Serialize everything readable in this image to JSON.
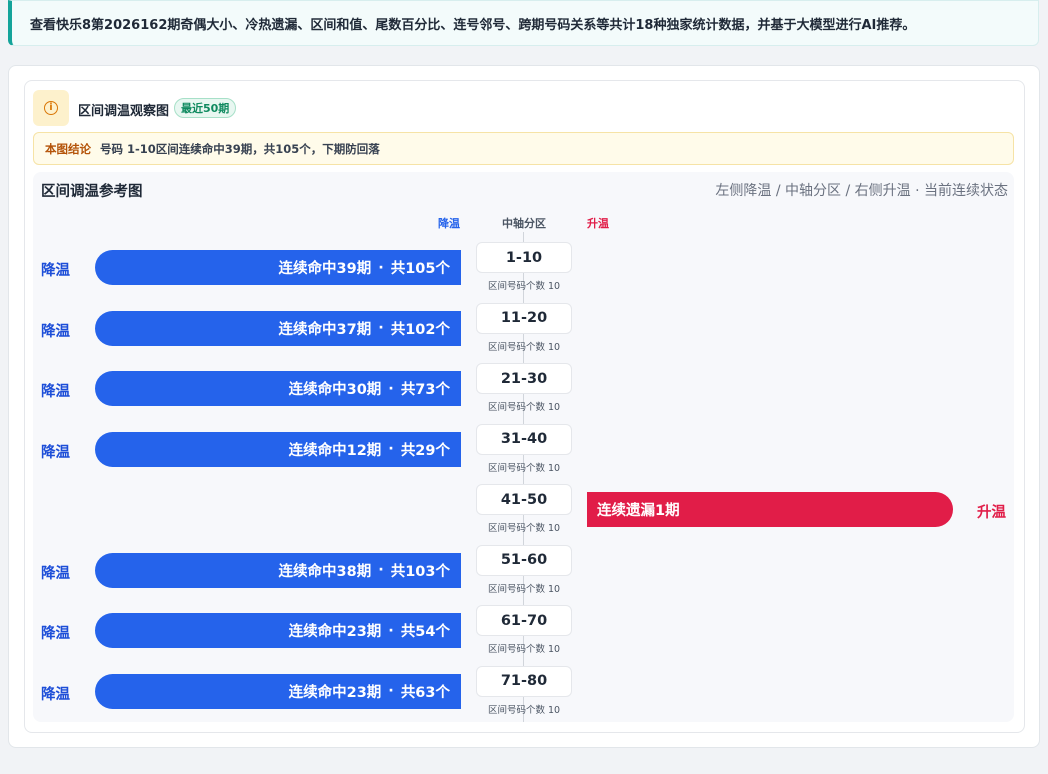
{
  "notice": "查看快乐8第2026162期奇偶大小、冷热遗漏、区间和值、尾数百分比、连号邻号、跨期号码关系等共计18种独家统计数据，并基于大模型进行AI推荐。",
  "card": {
    "icon": "info-icon",
    "title": "区间调温观察图",
    "badge": "最近50期"
  },
  "conclusion": {
    "label": "本图结论",
    "text": "号码 1-10区间连续命中39期，共105个，下期防回落"
  },
  "chart": {
    "title": "区间调温参考图",
    "subtitle": "左侧降温 / 中轴分区 / 右侧升温 · 当前连续状态",
    "header_cool": "降温",
    "header_axis": "中轴分区",
    "header_warm": "升温",
    "colors": {
      "cool": "#2563eb",
      "warm": "#e11d48"
    }
  },
  "chart_data": {
    "type": "bar",
    "categories": [
      "1-10",
      "11-20",
      "21-30",
      "31-40",
      "41-50",
      "51-60",
      "61-70",
      "71-80"
    ],
    "rows": [
      {
        "zone": "1-10",
        "count_label": "区间号码个数 10",
        "direction": "cool",
        "dir_label": "降温",
        "bar_text": "连续命中39期",
        "total_text": "共105个",
        "streak": 39,
        "total": 105
      },
      {
        "zone": "11-20",
        "count_label": "区间号码个数 10",
        "direction": "cool",
        "dir_label": "降温",
        "bar_text": "连续命中37期",
        "total_text": "共102个",
        "streak": 37,
        "total": 102
      },
      {
        "zone": "21-30",
        "count_label": "区间号码个数 10",
        "direction": "cool",
        "dir_label": "降温",
        "bar_text": "连续命中30期",
        "total_text": "共73个",
        "streak": 30,
        "total": 73
      },
      {
        "zone": "31-40",
        "count_label": "区间号码个数 10",
        "direction": "cool",
        "dir_label": "降温",
        "bar_text": "连续命中12期",
        "total_text": "共29个",
        "streak": 12,
        "total": 29
      },
      {
        "zone": "41-50",
        "count_label": "区间号码个数 10",
        "direction": "warm",
        "dir_label": "升温",
        "bar_text": "连续遗漏1期",
        "total_text": "",
        "streak": 1,
        "total": null
      },
      {
        "zone": "51-60",
        "count_label": "区间号码个数 10",
        "direction": "cool",
        "dir_label": "降温",
        "bar_text": "连续命中38期",
        "total_text": "共103个",
        "streak": 38,
        "total": 103
      },
      {
        "zone": "61-70",
        "count_label": "区间号码个数 10",
        "direction": "cool",
        "dir_label": "降温",
        "bar_text": "连续命中23期",
        "total_text": "共54个",
        "streak": 23,
        "total": 54
      },
      {
        "zone": "71-80",
        "count_label": "区间号码个数 10",
        "direction": "cool",
        "dir_label": "降温",
        "bar_text": "连续命中23期",
        "total_text": "共63个",
        "streak": 23,
        "total": 63
      }
    ],
    "separator": "·"
  }
}
